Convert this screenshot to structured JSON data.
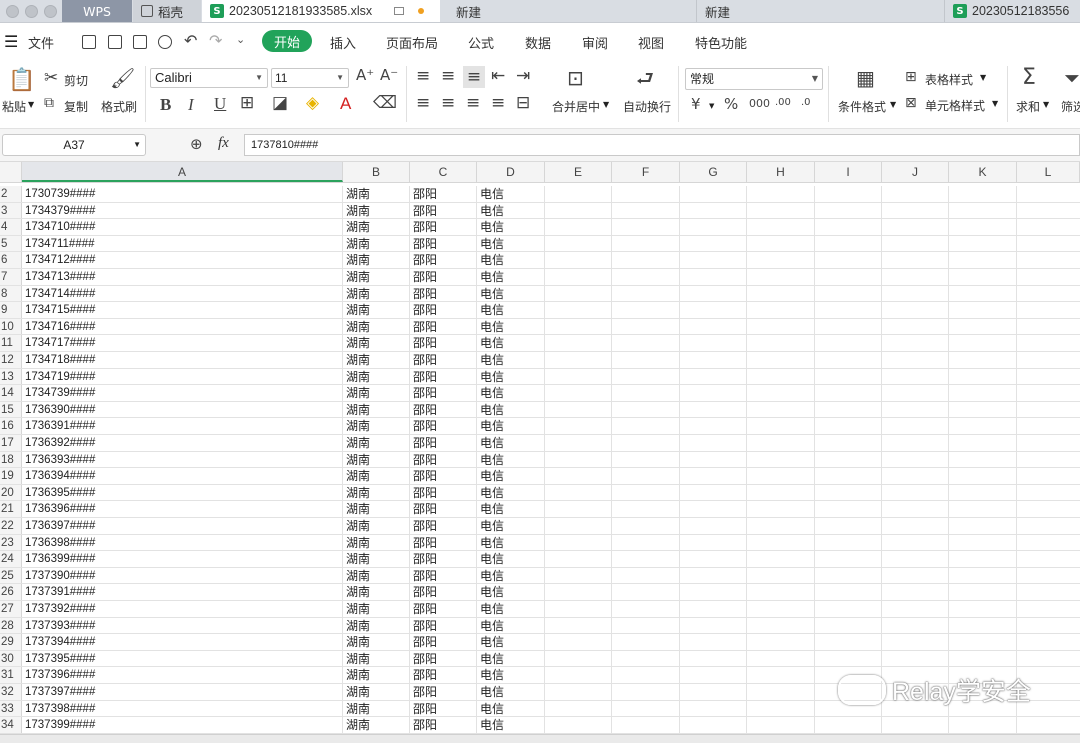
{
  "tabs": {
    "wps": "WPS",
    "daoke": "稻壳",
    "active_file": "20230512181933585.xlsx",
    "new_1": "新建",
    "new_2": "新建",
    "file_2": "20230512183556"
  },
  "menu": {
    "file": "文件",
    "items": [
      "开始",
      "插入",
      "页面布局",
      "公式",
      "数据",
      "审阅",
      "视图",
      "特色功能"
    ]
  },
  "ribbon": {
    "paste": "粘贴",
    "cut": "剪切",
    "copy": "复制",
    "format_painter": "格式刷",
    "font_name": "Calibri",
    "font_size": "11",
    "merge_center": "合并居中",
    "wrap_text": "自动换行",
    "number_format": "常规",
    "conditional_format": "条件格式",
    "table_style": "表格样式",
    "cell_style": "单元格样式",
    "sum": "求和",
    "filter": "筛选"
  },
  "formula_bar": {
    "name_box": "A37",
    "fx": "fx",
    "content": "1737810####"
  },
  "columns": [
    "A",
    "B",
    "C",
    "D",
    "E",
    "F",
    "G",
    "H",
    "I",
    "J",
    "K",
    "L"
  ],
  "rows": [
    {
      "n": "2",
      "a": "1730739####",
      "b": "湖南",
      "c": "邵阳",
      "d": "电信"
    },
    {
      "n": "3",
      "a": "1734379####",
      "b": "湖南",
      "c": "邵阳",
      "d": "电信"
    },
    {
      "n": "4",
      "a": "1734710####",
      "b": "湖南",
      "c": "邵阳",
      "d": "电信"
    },
    {
      "n": "5",
      "a": "1734711####",
      "b": "湖南",
      "c": "邵阳",
      "d": "电信"
    },
    {
      "n": "6",
      "a": "1734712####",
      "b": "湖南",
      "c": "邵阳",
      "d": "电信"
    },
    {
      "n": "7",
      "a": "1734713####",
      "b": "湖南",
      "c": "邵阳",
      "d": "电信"
    },
    {
      "n": "8",
      "a": "1734714####",
      "b": "湖南",
      "c": "邵阳",
      "d": "电信"
    },
    {
      "n": "9",
      "a": "1734715####",
      "b": "湖南",
      "c": "邵阳",
      "d": "电信"
    },
    {
      "n": "10",
      "a": "1734716####",
      "b": "湖南",
      "c": "邵阳",
      "d": "电信"
    },
    {
      "n": "11",
      "a": "1734717####",
      "b": "湖南",
      "c": "邵阳",
      "d": "电信"
    },
    {
      "n": "12",
      "a": "1734718####",
      "b": "湖南",
      "c": "邵阳",
      "d": "电信"
    },
    {
      "n": "13",
      "a": "1734719####",
      "b": "湖南",
      "c": "邵阳",
      "d": "电信"
    },
    {
      "n": "14",
      "a": "1734739####",
      "b": "湖南",
      "c": "邵阳",
      "d": "电信"
    },
    {
      "n": "15",
      "a": "1736390####",
      "b": "湖南",
      "c": "邵阳",
      "d": "电信"
    },
    {
      "n": "16",
      "a": "1736391####",
      "b": "湖南",
      "c": "邵阳",
      "d": "电信"
    },
    {
      "n": "17",
      "a": "1736392####",
      "b": "湖南",
      "c": "邵阳",
      "d": "电信"
    },
    {
      "n": "18",
      "a": "1736393####",
      "b": "湖南",
      "c": "邵阳",
      "d": "电信"
    },
    {
      "n": "19",
      "a": "1736394####",
      "b": "湖南",
      "c": "邵阳",
      "d": "电信"
    },
    {
      "n": "20",
      "a": "1736395####",
      "b": "湖南",
      "c": "邵阳",
      "d": "电信"
    },
    {
      "n": "21",
      "a": "1736396####",
      "b": "湖南",
      "c": "邵阳",
      "d": "电信"
    },
    {
      "n": "22",
      "a": "1736397####",
      "b": "湖南",
      "c": "邵阳",
      "d": "电信"
    },
    {
      "n": "23",
      "a": "1736398####",
      "b": "湖南",
      "c": "邵阳",
      "d": "电信"
    },
    {
      "n": "24",
      "a": "1736399####",
      "b": "湖南",
      "c": "邵阳",
      "d": "电信"
    },
    {
      "n": "25",
      "a": "1737390####",
      "b": "湖南",
      "c": "邵阳",
      "d": "电信"
    },
    {
      "n": "26",
      "a": "1737391####",
      "b": "湖南",
      "c": "邵阳",
      "d": "电信"
    },
    {
      "n": "27",
      "a": "1737392####",
      "b": "湖南",
      "c": "邵阳",
      "d": "电信"
    },
    {
      "n": "28",
      "a": "1737393####",
      "b": "湖南",
      "c": "邵阳",
      "d": "电信"
    },
    {
      "n": "29",
      "a": "1737394####",
      "b": "湖南",
      "c": "邵阳",
      "d": "电信"
    },
    {
      "n": "30",
      "a": "1737395####",
      "b": "湖南",
      "c": "邵阳",
      "d": "电信"
    },
    {
      "n": "31",
      "a": "1737396####",
      "b": "湖南",
      "c": "邵阳",
      "d": "电信"
    },
    {
      "n": "32",
      "a": "1737397####",
      "b": "湖南",
      "c": "邵阳",
      "d": "电信"
    },
    {
      "n": "33",
      "a": "1737398####",
      "b": "湖南",
      "c": "邵阳",
      "d": "电信"
    },
    {
      "n": "34",
      "a": "1737399####",
      "b": "湖南",
      "c": "邵阳",
      "d": "电信"
    }
  ],
  "watermark": "Relay学安全",
  "accent_color": "#21a35a"
}
